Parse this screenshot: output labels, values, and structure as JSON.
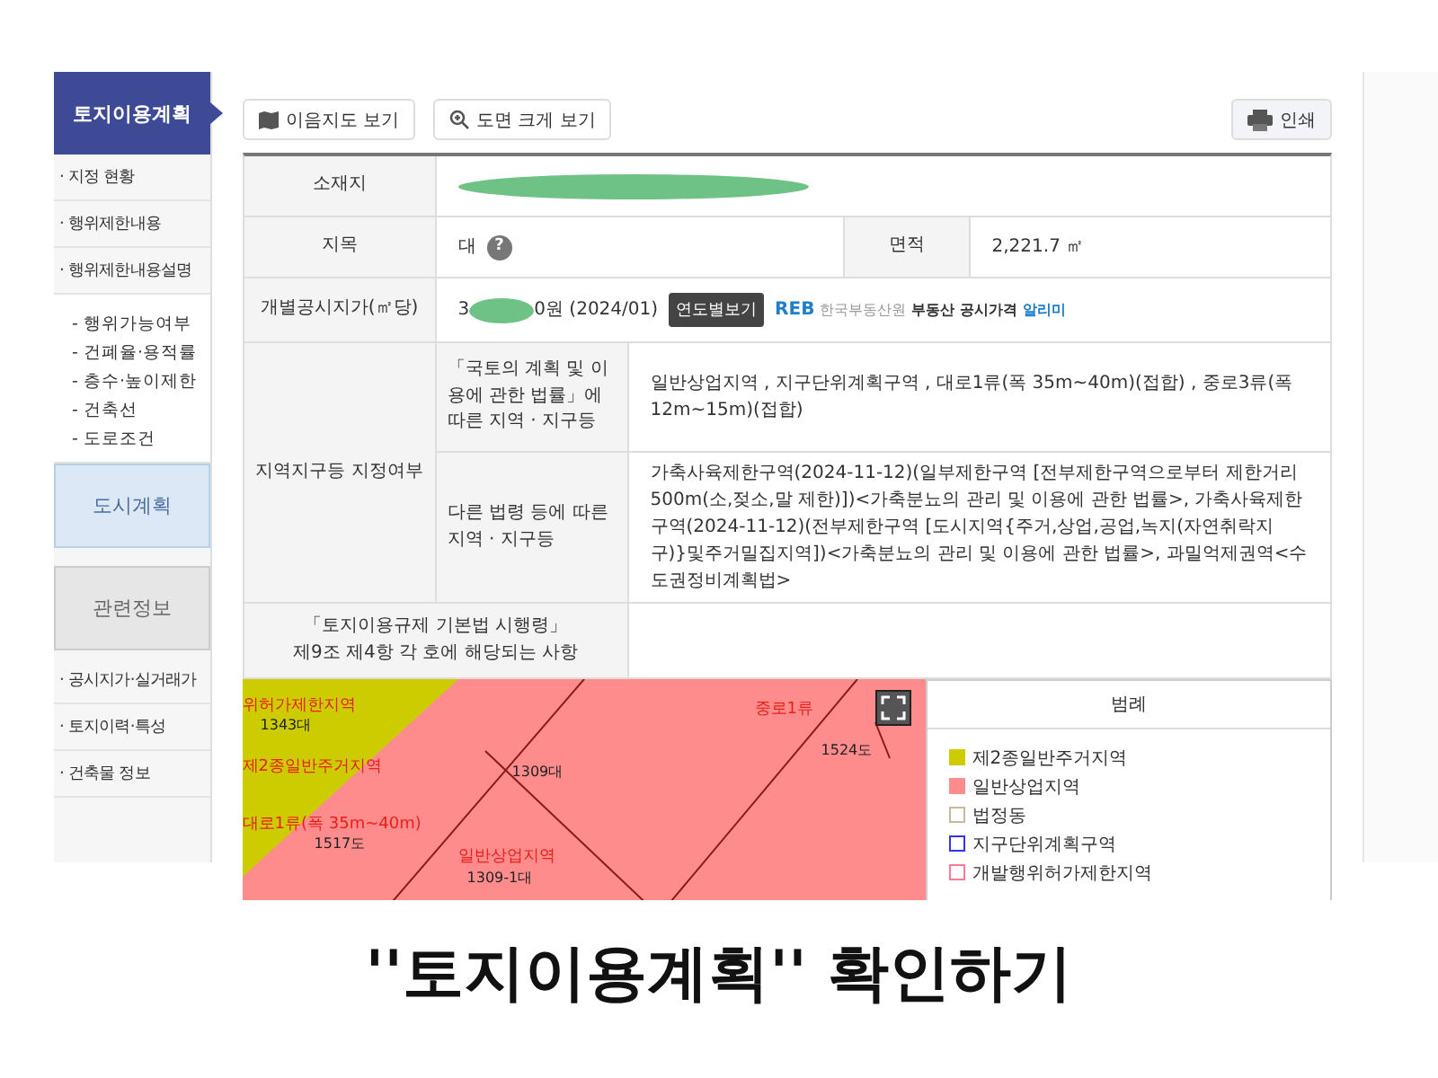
{
  "sidebar": {
    "items": [
      {
        "kind": "head",
        "label": "토지이용계획",
        "selected": true
      },
      {
        "kind": "link",
        "label": "· 지정 현황",
        "selected": false
      },
      {
        "kind": "link",
        "label": "· 행위제한내용",
        "selected": false
      },
      {
        "kind": "link",
        "label": "· 행위제한내용설명",
        "selected": false
      },
      {
        "kind": "group",
        "children": [
          {
            "label": "- 행위가능여부"
          },
          {
            "label": "- 건폐율·용적률"
          },
          {
            "label": "- 층수·높이제한"
          },
          {
            "label": "- 건축선"
          },
          {
            "label": "- 도로조건"
          }
        ]
      },
      {
        "kind": "section",
        "label": "도시계획",
        "selected": true
      },
      {
        "kind": "section",
        "label": "관련정보",
        "selected": false
      },
      {
        "kind": "link",
        "label": "· 공시지가·실거래가",
        "selected": false
      },
      {
        "kind": "link",
        "label": "· 토지이력·특성",
        "selected": false
      },
      {
        "kind": "link",
        "label": "· 건축물 정보",
        "selected": false
      }
    ]
  },
  "toolbar": {
    "left": [
      {
        "label": "이음지도 보기"
      },
      {
        "label": "도면 크게 보기"
      }
    ],
    "right": {
      "label": "인쇄"
    }
  },
  "table": {
    "address_label": "소재지",
    "address_redacted": true,
    "jimok_label": "지목",
    "jimok": "대",
    "jimok_help": "?",
    "area_label": "면적",
    "area": "2,221.7 ㎡",
    "price_label": "개별공시지가(㎡당)",
    "price_head": "3",
    "price_redacted": true,
    "price_tail": "0원 (2024/01)",
    "price_button": "연도별보기",
    "reb_logo": "REB",
    "reb_org": "한국부동산원",
    "reb_service": "부동산 공시가격",
    "reb_service_highlight": "알리미",
    "zone_label": "지역지구등 지정여부",
    "zones": [
      {
        "label": "「국토의 계획 및 이용에 관한 법률」에 따른 지역 · 지구등",
        "value": "일반상업지역 , 지구단위계획구역 , 대로1류(폭 35m~40m)(접합) , 중로3류(폭 12m~15m)(접합)"
      },
      {
        "label": "다른 법령 등에 따른 지역 · 지구등",
        "value": "가축사육제한구역(2024-11-12)(일부제한구역 [전부제한구역으로부터 제한거리 500m(소,젖소,말 제한)])<가축분뇨의 관리 및 이용에 관한 법률>, 가축사육제한구역(2024-11-12)(전부제한구역 [도시지역{주거,상업,공업,녹지(자연취락지구)}및주거밀집지역])<가축분뇨의 관리 및 이용에 관한 법률>, 과밀억제권역<수도권정비계획법>"
      }
    ],
    "decree_label_1": "「토지이용규제 기본법 시행령」",
    "decree_label_2": "제9조 제4항 각 호에 해당되는 사항"
  },
  "map": {
    "labels": [
      {
        "text": "위허가제한지역",
        "kind": "zone"
      },
      {
        "text": "1343대",
        "kind": "lot"
      },
      {
        "text": "제2종일반주거지역",
        "kind": "zone"
      },
      {
        "text": "대로1류(폭 35m~40m)",
        "kind": "zone"
      },
      {
        "text": "1517도",
        "kind": "lot"
      },
      {
        "text": "1309대",
        "kind": "lot"
      },
      {
        "text": "일반상업지역",
        "kind": "zone"
      },
      {
        "text": "1309-1대",
        "kind": "lot"
      },
      {
        "text": "중로1류",
        "kind": "zone"
      },
      {
        "text": "1524도",
        "kind": "lot"
      }
    ]
  },
  "legend": {
    "title": "범례",
    "items": [
      {
        "label": "제2종일반주거지역",
        "kind": "filled",
        "color": "#cccc00"
      },
      {
        "label": "일반상업지역",
        "kind": "filled",
        "color": "#ff8c8c"
      },
      {
        "label": "법정동",
        "kind": "outline",
        "color": "#c8b8a0"
      },
      {
        "label": "지구단위계획구역",
        "kind": "outline",
        "color": "#3333ff"
      },
      {
        "label": "개발행위허가제한지역",
        "kind": "outline",
        "color": "#ff7a9a"
      }
    ]
  },
  "caption": "''토지이용계획'' 확인하기"
}
